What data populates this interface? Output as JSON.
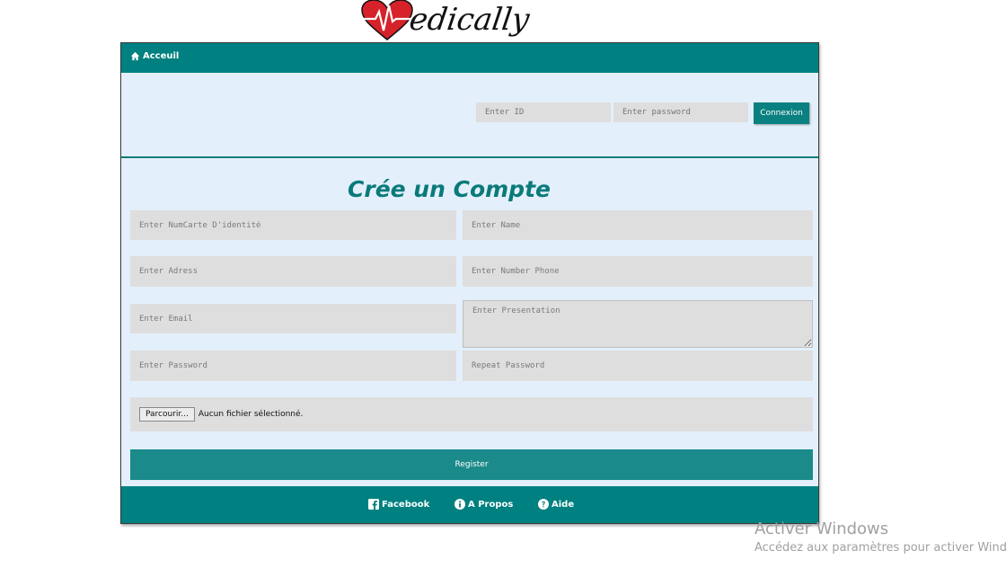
{
  "logo": {
    "text": "edically"
  },
  "topbar": {
    "home_label": "Acceuil"
  },
  "login": {
    "id_placeholder": "Enter ID",
    "password_placeholder": "Enter password",
    "connexion_label": "Connexion"
  },
  "form": {
    "title": "Crée un Compte",
    "numcarte_placeholder": "Enter NumCarte D'identité",
    "name_placeholder": "Enter Name",
    "adress_placeholder": "Enter Adress",
    "phone_placeholder": "Enter Number Phone",
    "email_placeholder": "Enter Email",
    "presentation_placeholder": "Enter Presentation",
    "password_placeholder": "Enter Password",
    "repeat_password_placeholder": "Repeat Password",
    "browse_label": "Parcourir...",
    "file_status": "Aucun fichier sélectionné.",
    "register_label": "Register"
  },
  "footer": {
    "facebook_label": "Facebook",
    "apropos_label": "A Propos",
    "aide_label": "Aide"
  },
  "watermark": {
    "title": "Activer Windows",
    "subtitle": "Accédez aux paramètres pour activer Windows."
  },
  "colors": {
    "teal": "#008080",
    "panel": "#e3f0fb",
    "field": "#dedede",
    "heart": "#d6222a"
  }
}
